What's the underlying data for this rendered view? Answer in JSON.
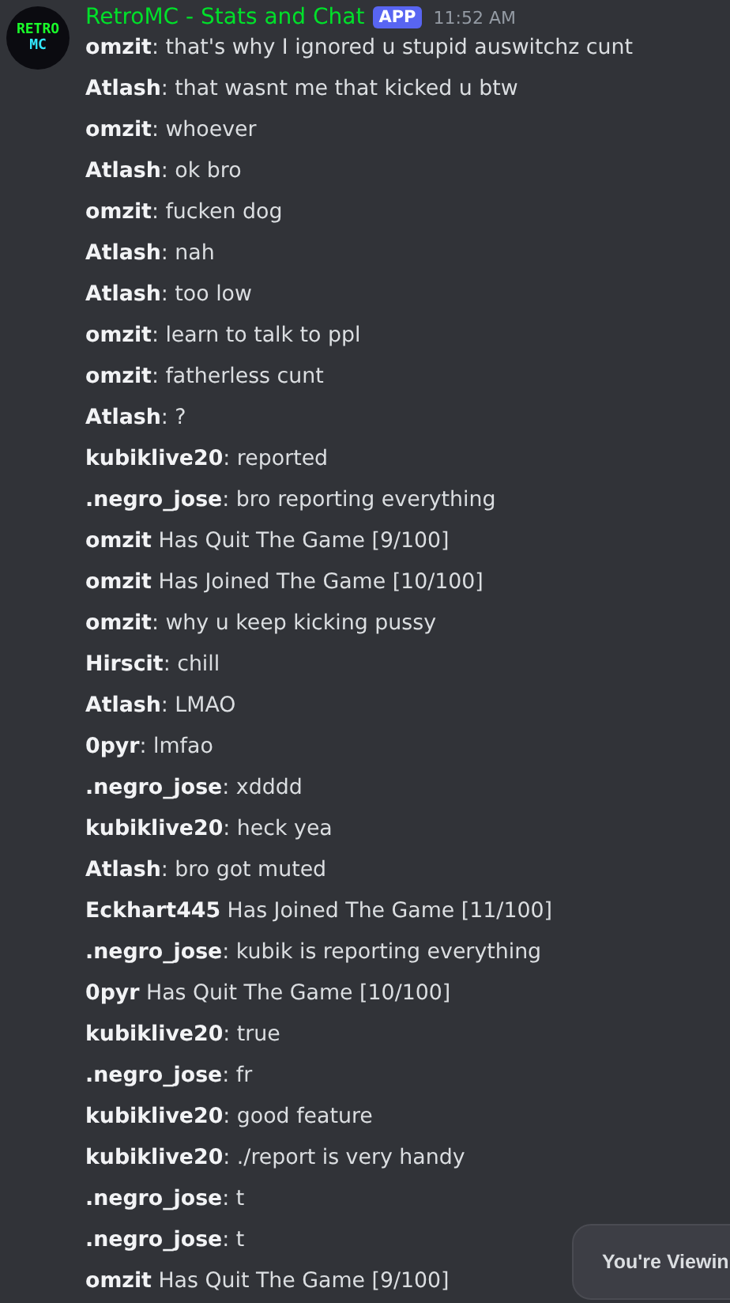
{
  "message": {
    "avatar": {
      "line_1": "RETRO",
      "line_2": "MC"
    },
    "author": "RetroMC - Stats and Chat",
    "badge": "APP",
    "time": "11:52 AM",
    "lines": [
      "**omzit**: that's why I ignored u stupid auswitchz cunt",
      "**Atlash**: that wasnt me that kicked u btw",
      "**omzit**: whoever",
      "**Atlash**: ok bro",
      "**omzit**: fucken dog",
      "**Atlash**: nah",
      "**Atlash**: too low",
      "**omzit**: learn to talk to ppl",
      "**omzit**: fatherless cunt",
      "**Atlash**: ?",
      "**kubiklive20**: reported",
      "**.negro_jose**: bro reporting everything",
      "**omzit** Has Quit The Game [9/100]",
      "**omzit** Has Joined The Game [10/100]",
      "**omzit**: why u keep kicking pussy",
      "**Hirscit**: chill",
      "**Atlash**: LMAO",
      "**0pyr**: lmfao",
      "**.negro_jose**: xdddd",
      "**kubiklive20**: heck yea",
      "**Atlash**: bro got muted",
      "**Eckhart445** Has Joined The Game [11/100]",
      "**.negro_jose**: kubik is reporting everything",
      "**0pyr** Has Quit The Game [10/100]",
      "**kubiklive20**: true",
      "**.negro_jose**: fr",
      "**kubiklive20**: good feature",
      "**kubiklive20**: ./report is very handy",
      "**.negro_jose**: t",
      "**.negro_jose**: t",
      "**omzit** Has Quit The Game [9/100]"
    ]
  },
  "toast": {
    "text": "You're Viewin"
  }
}
